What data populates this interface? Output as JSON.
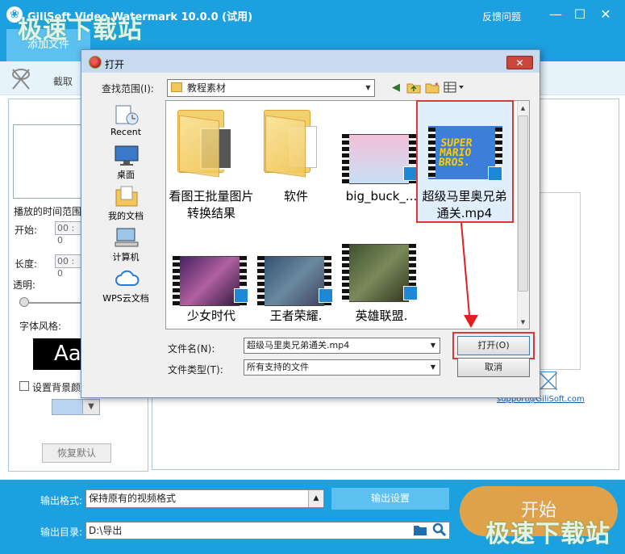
{
  "app": {
    "title": "GiliSoft Video Watermark 10.0.0 (试用)",
    "feedback": "反馈问题",
    "window_controls": {
      "minimize": "—",
      "maximize": "☐",
      "close": "✕"
    }
  },
  "toolbar": {
    "add_file": "添加文件",
    "crop": "截取"
  },
  "left_panel": {
    "play_range": "播放的时间范围",
    "start_label": "开始:",
    "start_value": "00 : 0",
    "length_label": "长度:",
    "length_value": "00 : 0",
    "transparency_label": "透明:",
    "font_style_label": "字体风格:",
    "font_preview": "Aa",
    "bg_color_label": "设置背景颜",
    "reset_button": "恢复默认"
  },
  "right_panel": {
    "support_link": "support@GiliSoft.com"
  },
  "bottom": {
    "format_label": "输出格式:",
    "format_value": "保持原有的视频格式",
    "output_settings": "输出设置",
    "dir_label": "输出目录:",
    "dir_value": "D:\\导出",
    "start_button": "开始"
  },
  "watermark": {
    "text": "极速下载站"
  },
  "dialog": {
    "title": "打开",
    "close": "✕",
    "look_in_label": "查找范围(I):",
    "look_in_value": "教程素材",
    "places": [
      {
        "label": "Recent"
      },
      {
        "label": "桌面"
      },
      {
        "label": "我的文档"
      },
      {
        "label": "计算机"
      },
      {
        "label": "WPS云文档"
      }
    ],
    "files": [
      {
        "label": "看图王批量图片转换结果",
        "kind": "folder"
      },
      {
        "label": "软件",
        "kind": "folder"
      },
      {
        "label": "big_buck_...",
        "kind": "video"
      },
      {
        "label": "超级马里奥兄弟通关.mp4",
        "kind": "video",
        "selected": true
      },
      {
        "label": "少女时代",
        "kind": "video"
      },
      {
        "label": "王者荣耀.",
        "kind": "video"
      },
      {
        "label": "英雄联盟.",
        "kind": "video"
      }
    ],
    "mario_title": "SUPER MARIO BROS.",
    "filename_label": "文件名(N):",
    "filename_value": "超级马里奥兄弟通关.mp4",
    "filetype_label": "文件类型(T):",
    "filetype_value": "所有支持的文件",
    "open_button": "打开(O)",
    "cancel_button": "取消"
  },
  "colors": {
    "app_blue": "#1da0e0",
    "accent_light_blue": "#5cc0f0",
    "start_orange": "#f5a33a",
    "highlight_red": "#d83a3a"
  }
}
